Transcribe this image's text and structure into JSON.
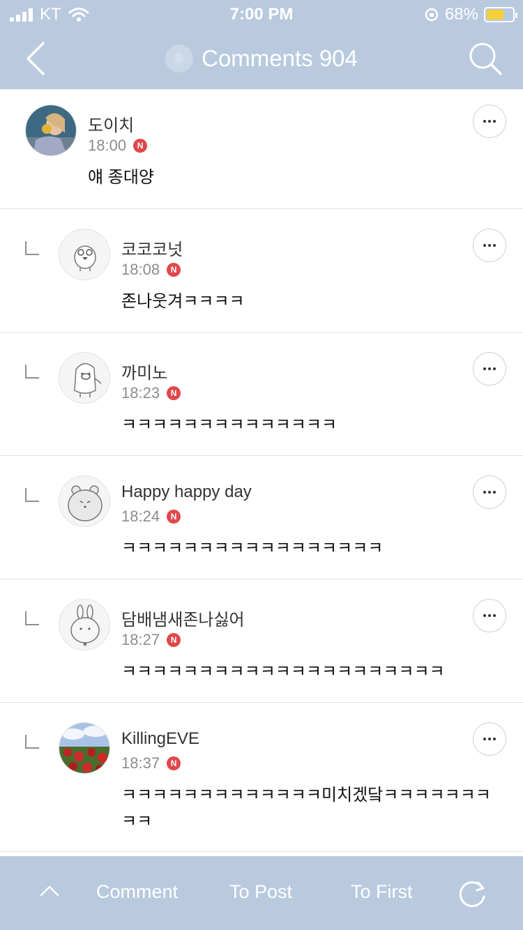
{
  "status": {
    "carrier": "KT",
    "time": "7:00 PM",
    "battery": "68%",
    "battery_level": 0.68
  },
  "nav": {
    "title": "Comments 904"
  },
  "comments": [
    {
      "name": "도이치",
      "time": "18:00",
      "badge": "N",
      "text": "얘 종대양",
      "avatar": "photo-woman-icon"
    },
    {
      "name": "코코코넛",
      "time": "18:08",
      "badge": "N",
      "text": "존나웃겨ㅋㅋㅋㅋ",
      "avatar": "chick-character-icon"
    },
    {
      "name": "까미노",
      "time": "18:23",
      "badge": "N",
      "text": "ㅋㅋㅋㅋㅋㅋㅋㅋㅋㅋㅋㅋㅋㅋ",
      "avatar": "penguin-character-icon"
    },
    {
      "name": "Happy happy day",
      "time": "18:24",
      "badge": "N",
      "text": "ㅋㅋㅋㅋㅋㅋㅋㅋㅋㅋㅋㅋㅋㅋㅋㅋㅋ",
      "avatar": "bear-character-icon"
    },
    {
      "name": "담배냄새존나싫어",
      "time": "18:27",
      "badge": "N",
      "text": "ㅋㅋㅋㅋㅋㅋㅋㅋㅋㅋㅋㅋㅋㅋㅋㅋㅋㅋㅋㅋㅋ",
      "avatar": "bunny-character-icon"
    },
    {
      "name": "KillingEVE",
      "time": "18:37",
      "badge": "N",
      "text": "ㅋㅋㅋㅋㅋㅋㅋㅋㅋㅋㅋㅋㅋ미치겠닼ㅋㅋㅋㅋㅋㅋㅋㅋㅋ",
      "avatar": "photo-roses-icon"
    }
  ],
  "toolbar": {
    "comment": "Comment",
    "to_post": "To Post",
    "to_first": "To First"
  }
}
